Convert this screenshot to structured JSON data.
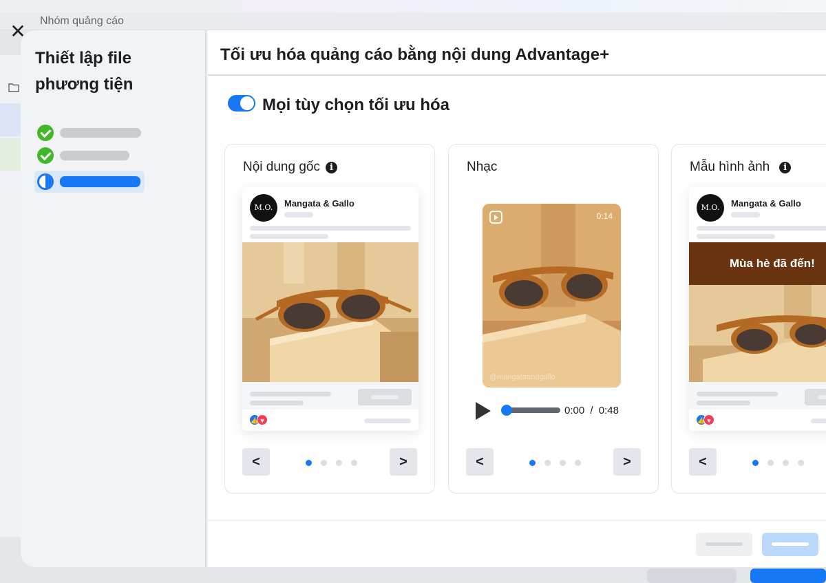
{
  "background": {
    "breadcrumb": "Nhóm quảng cáo",
    "close_glyph": "✕"
  },
  "sidebar": {
    "title": "Thiết lập file\nphương tiện",
    "steps": [
      {
        "status": "done",
        "icon": "check-circle-icon"
      },
      {
        "status": "done",
        "icon": "check-circle-icon"
      },
      {
        "status": "in-progress",
        "icon": "half-circle-icon"
      }
    ]
  },
  "main": {
    "title": "Tối ưu hóa quảng cáo bằng nội dung Advantage+",
    "toggle": {
      "label": "Mọi tùy chọn tối ưu hóa",
      "on": true
    },
    "cards": [
      {
        "title": "Nội dung gốc",
        "info_glyph": "i",
        "post": {
          "avatar_text": "M.O.",
          "page_name": "Mangata & Gallo"
        },
        "nav": {
          "prev": "<",
          "next": ">"
        },
        "page_index": 1,
        "page_count": 4
      },
      {
        "title": "Nhạc",
        "video": {
          "duration_badge": "0:14",
          "handle": "@mangataandgallo"
        },
        "player": {
          "current": "0:00",
          "separator": "/",
          "total": "0:48"
        },
        "nav": {
          "prev": "<",
          "next": ">"
        },
        "page_index": 1,
        "page_count": 4
      },
      {
        "title": "Mẫu hình ảnh",
        "info_glyph": "i",
        "post": {
          "avatar_text": "M.O.",
          "page_name": "Mangata & Gallo",
          "banner_text": "Mùa hè đã đến!"
        },
        "nav": {
          "prev": "<"
        },
        "page_index": 1,
        "page_count": 4
      }
    ]
  },
  "colors": {
    "accent": "#1877f2",
    "success": "#42b72a",
    "banner": "#6b3410"
  }
}
